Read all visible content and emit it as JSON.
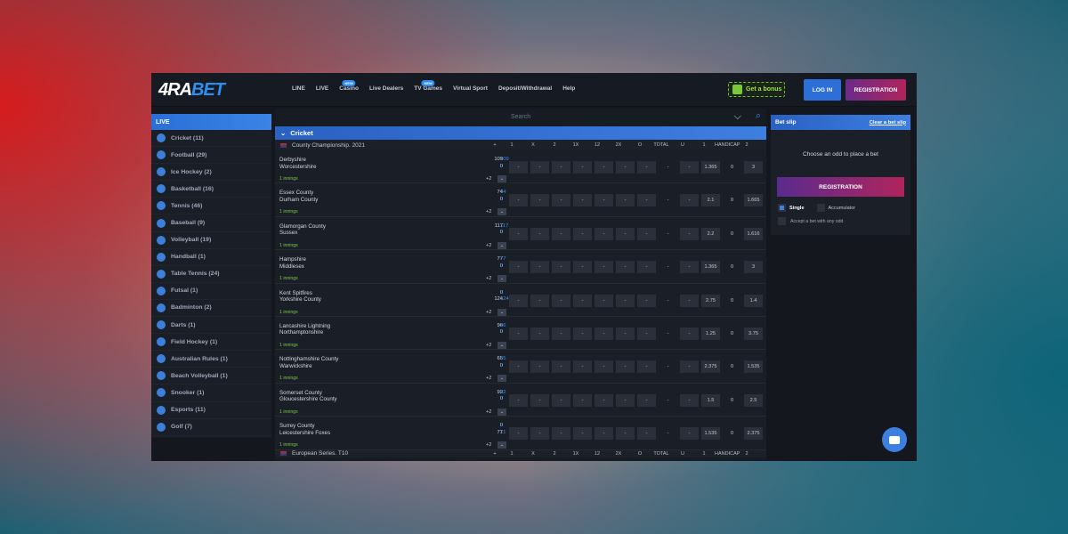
{
  "header": {
    "logo_main": "4RA",
    "logo_accent": "BET",
    "nav": [
      {
        "label": "LINE",
        "badge": ""
      },
      {
        "label": "LIVE",
        "badge": ""
      },
      {
        "label": "Casino",
        "badge": "NEW"
      },
      {
        "label": "Live Dealers",
        "badge": ""
      },
      {
        "label": "TV Games",
        "badge": "NEW"
      },
      {
        "label": "Virtual Sport",
        "badge": ""
      },
      {
        "label": "Deposit/Withdrawal",
        "badge": ""
      },
      {
        "label": "Help",
        "badge": ""
      }
    ],
    "bonus_label": "Get a bonus",
    "login_label": "LOG IN",
    "register_label": "REGISTRATION"
  },
  "sidebar": {
    "title": "LIVE",
    "items": [
      {
        "label": "Cricket (11)",
        "icon": "cricket-icon"
      },
      {
        "label": "Football (29)",
        "icon": "football-icon"
      },
      {
        "label": "Ice Hockey (2)",
        "icon": "ice-hockey-icon"
      },
      {
        "label": "Basketball (16)",
        "icon": "basketball-icon"
      },
      {
        "label": "Tennis (46)",
        "icon": "tennis-icon"
      },
      {
        "label": "Baseball (9)",
        "icon": "baseball-icon"
      },
      {
        "label": "Volleyball (19)",
        "icon": "volleyball-icon"
      },
      {
        "label": "Handball (1)",
        "icon": "handball-icon"
      },
      {
        "label": "Table Tennis (24)",
        "icon": "table-tennis-icon"
      },
      {
        "label": "Futsal (1)",
        "icon": "futsal-icon"
      },
      {
        "label": "Badminton (2)",
        "icon": "badminton-icon"
      },
      {
        "label": "Darts (1)",
        "icon": "darts-icon"
      },
      {
        "label": "Field Hockey (1)",
        "icon": "field-hockey-icon"
      },
      {
        "label": "Australian Rules (1)",
        "icon": "australian-rules-icon"
      },
      {
        "label": "Beach Volleyball (1)",
        "icon": "beach-volleyball-icon"
      },
      {
        "label": "Snooker (1)",
        "icon": "snooker-icon"
      },
      {
        "label": "Esports (11)",
        "icon": "esports-icon"
      },
      {
        "label": "Golf (7)",
        "icon": "golf-icon"
      }
    ]
  },
  "main": {
    "search_placeholder": "Search",
    "sport_title": "Cricket",
    "league": "County Championship. 2021",
    "columns": [
      "+",
      "1",
      "X",
      "2",
      "1X",
      "12",
      "2X",
      "O",
      "TOTAL",
      "U",
      "1",
      "HANDICAP",
      "2"
    ],
    "matches": [
      {
        "team1": "Derbyshire",
        "team2": "Worcestershire",
        "s1": "109",
        "s2": "0",
        "b1": "109",
        "b2": "0",
        "info": "1 innings",
        "more": "+2",
        "odds": [
          "-",
          "-",
          "-",
          "-",
          "-",
          "-",
          "-",
          "-",
          "-",
          "1.365",
          "0",
          "3"
        ]
      },
      {
        "team1": "Essex County",
        "team2": "Durham County",
        "s1": "74",
        "s2": "0",
        "b1": "74",
        "b2": "0",
        "info": "1 innings",
        "more": "+2",
        "odds": [
          "-",
          "-",
          "-",
          "-",
          "-",
          "-",
          "-",
          "-",
          "-",
          "2.1",
          "0",
          "1.665"
        ]
      },
      {
        "team1": "Glamorgan County",
        "team2": "Sussex",
        "s1": "117",
        "s2": "0",
        "b1": "117",
        "b2": "0",
        "info": "1 innings",
        "more": "+2",
        "odds": [
          "-",
          "-",
          "-",
          "-",
          "-",
          "-",
          "-",
          "-",
          "-",
          "2.2",
          "0",
          "1.616"
        ]
      },
      {
        "team1": "Hampshire",
        "team2": "Middlesex",
        "s1": "77",
        "s2": "0",
        "b1": "77",
        "b2": "0",
        "info": "1 innings",
        "more": "+2",
        "odds": [
          "-",
          "-",
          "-",
          "-",
          "-",
          "-",
          "-",
          "-",
          "-",
          "1.365",
          "0",
          "3"
        ]
      },
      {
        "team1": "Kent Spitfires",
        "team2": "Yorkshire County",
        "s1": "0",
        "s2": "124",
        "b1": "0",
        "b2": "124",
        "info": "1 innings",
        "more": "+2",
        "odds": [
          "-",
          "-",
          "-",
          "-",
          "-",
          "-",
          "-",
          "-",
          "-",
          "2.75",
          "0",
          "1.4"
        ]
      },
      {
        "team1": "Lancashire Lightning",
        "team2": "Northamptonshire",
        "s1": "96",
        "s2": "0",
        "b1": "96",
        "b2": "0",
        "info": "1 innings",
        "more": "+2",
        "odds": [
          "-",
          "-",
          "-",
          "-",
          "-",
          "-",
          "-",
          "-",
          "-",
          "1.25",
          "0",
          "3.75"
        ]
      },
      {
        "team1": "Nottinghamshire County",
        "team2": "Warwickshire",
        "s1": "65",
        "s2": "0",
        "b1": "65",
        "b2": "0",
        "info": "1 innings",
        "more": "+2",
        "odds": [
          "-",
          "-",
          "-",
          "-",
          "-",
          "-",
          "-",
          "-",
          "-",
          "2.375",
          "0",
          "1.535"
        ]
      },
      {
        "team1": "Somerset County",
        "team2": "Gloucestershire County",
        "s1": "92",
        "s2": "0",
        "b1": "92",
        "b2": "0",
        "info": "1 innings",
        "more": "+2",
        "odds": [
          "-",
          "-",
          "-",
          "-",
          "-",
          "-",
          "-",
          "-",
          "-",
          "1.5",
          "0",
          "2.5"
        ]
      },
      {
        "team1": "Surrey County",
        "team2": "Leicestershire Foxes",
        "s1": "0",
        "s2": "71",
        "b1": "0",
        "b2": "71",
        "info": "1 innings",
        "more": "+2",
        "odds": [
          "-",
          "-",
          "-",
          "-",
          "-",
          "-",
          "-",
          "-",
          "-",
          "1.535",
          "0",
          "2.375"
        ]
      }
    ],
    "next_league": "European Series. T10",
    "next_columns": [
      "+",
      "1",
      "X",
      "2",
      "1X",
      "12",
      "2X",
      "O",
      "TOTAL",
      "U",
      "1",
      "HANDICAP",
      "2"
    ]
  },
  "betslip": {
    "title": "Bet slip",
    "clear_label": "Clear a bet slip",
    "empty_text": "Choose an odd to place a bet",
    "register_label": "REGISTRATION",
    "single_label": "Single",
    "accumulator_label": "Accumulator",
    "accept_label": "Accept a bet with any odd"
  },
  "colors": {
    "accent": "#3d7fe0",
    "brand_pink": "#b0245c",
    "bonus_green": "#9be04a"
  }
}
